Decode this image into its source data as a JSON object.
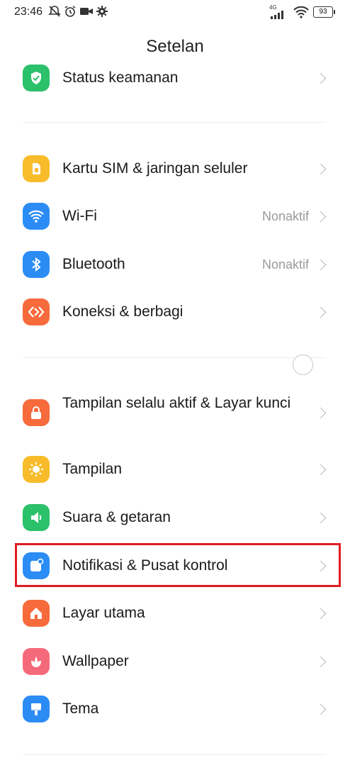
{
  "status_bar": {
    "time": "23:46",
    "network_type": "4G",
    "battery": "93",
    "icons": [
      "mute-bell-icon",
      "alarm-icon",
      "video-record-icon",
      "gear-icon",
      "signal-icon",
      "wifi-icon",
      "battery-icon"
    ]
  },
  "header": {
    "title": "Setelan"
  },
  "groups": [
    {
      "items": [
        {
          "label": "Status keamanan",
          "icon": "shield-check-icon",
          "color": "#2bc06a"
        }
      ]
    },
    {
      "items": [
        {
          "label": "Kartu SIM & jaringan seluler",
          "icon": "sim-card-icon",
          "color": "#f8bc2b"
        },
        {
          "label": "Wi-Fi",
          "value": "Nonaktif",
          "icon": "wifi-icon",
          "color": "#2c8cf5"
        },
        {
          "label": "Bluetooth",
          "value": "Nonaktif",
          "icon": "bluetooth-icon",
          "color": "#2c8cf5"
        },
        {
          "label": "Koneksi & berbagi",
          "icon": "connection-share-icon",
          "color": "#f66a3c"
        }
      ]
    },
    {
      "items": [
        {
          "label": "Tampilan selalu aktif & Layar kunci",
          "icon": "lock-icon",
          "color": "#f66a3c"
        },
        {
          "label": "Tampilan",
          "icon": "sun-icon",
          "color": "#f8bc2b"
        },
        {
          "label": "Suara & getaran",
          "icon": "speaker-icon",
          "color": "#2bc06a"
        },
        {
          "label": "Notifikasi & Pusat kontrol",
          "icon": "notification-icon",
          "color": "#2c8cf5",
          "highlighted": true
        },
        {
          "label": "Layar utama",
          "icon": "home-icon",
          "color": "#f66a3c"
        },
        {
          "label": "Wallpaper",
          "icon": "wallpaper-flower-icon",
          "color": "#f56a7b"
        },
        {
          "label": "Tema",
          "icon": "theme-brush-icon",
          "color": "#2c8cf5"
        }
      ]
    }
  ]
}
